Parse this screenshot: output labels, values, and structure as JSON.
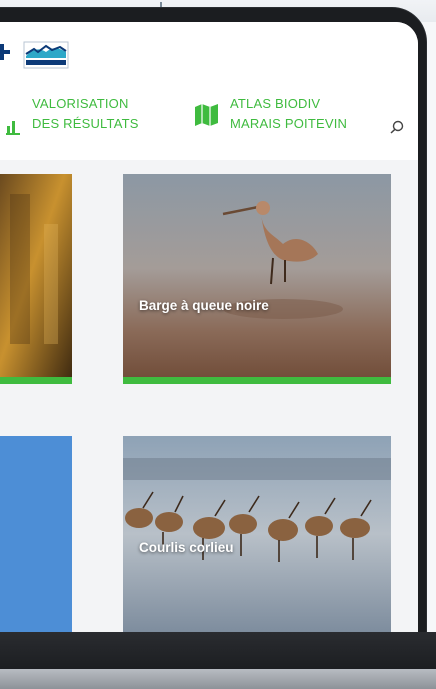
{
  "nav": {
    "items": [
      {
        "line1": "VALORISATION",
        "line2": "DES RÉSULTATS",
        "icon": "bar-chart-icon"
      },
      {
        "line1": "ATLAS BIODIV",
        "line2": "MARAIS POITEVIN",
        "icon": "map-icon"
      }
    ],
    "search_icon": "search-icon"
  },
  "cards": [
    {
      "caption": "Barge à queue noire"
    },
    {
      "caption": "Courlis corlieu"
    }
  ],
  "colors": {
    "accent": "#3fbb3f",
    "logo_navy": "#0c3a78",
    "logo_teal": "#2da8c8"
  }
}
